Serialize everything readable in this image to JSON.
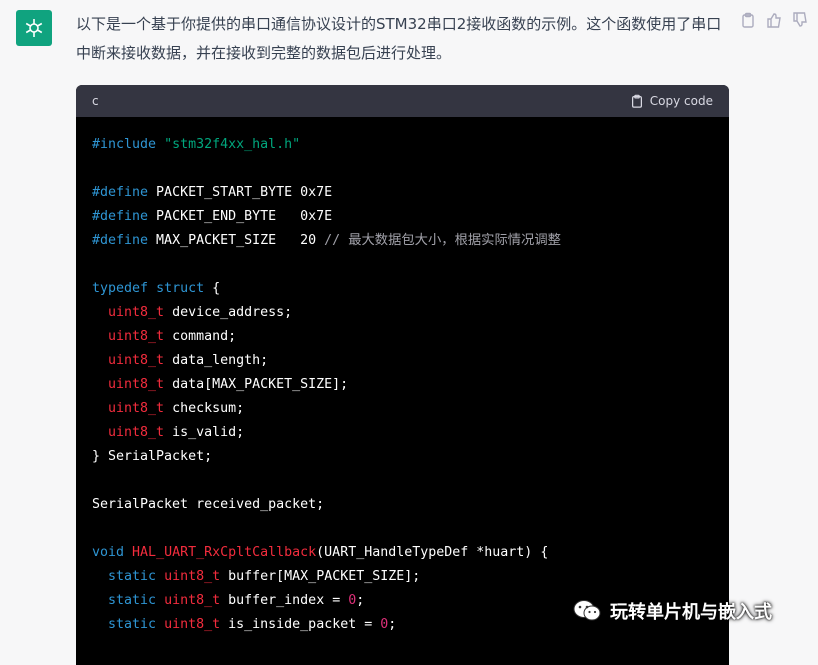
{
  "message": {
    "text": "以下是一个基于你提供的串口通信协议设计的STM32串口2接收函数的示例。这个函数使用了串口中断来接收数据，并在接收到完整的数据包后进行处理。"
  },
  "code_block": {
    "language": "c",
    "copy_label": "Copy code",
    "lines": [
      [
        {
          "t": "kw",
          "v": "#include "
        },
        {
          "t": "str",
          "v": "\"stm32f4xx_hal.h\""
        }
      ],
      [],
      [
        {
          "t": "kw",
          "v": "#define"
        },
        {
          "t": "pl",
          "v": " PACKET_START_BYTE 0x7E"
        }
      ],
      [
        {
          "t": "kw",
          "v": "#define"
        },
        {
          "t": "pl",
          "v": " PACKET_END_BYTE   0x7E"
        }
      ],
      [
        {
          "t": "kw",
          "v": "#define"
        },
        {
          "t": "pl",
          "v": " MAX_PACKET_SIZE   20 "
        },
        {
          "t": "cmt",
          "v": "// 最大数据包大小，根据实际情况调整"
        }
      ],
      [],
      [
        {
          "t": "kw",
          "v": "typedef"
        },
        {
          "t": "pl",
          "v": " "
        },
        {
          "t": "kw",
          "v": "struct"
        },
        {
          "t": "pl",
          "v": " {"
        }
      ],
      [
        {
          "t": "pl",
          "v": "  "
        },
        {
          "t": "ty",
          "v": "uint8_t"
        },
        {
          "t": "pl",
          "v": " device_address;"
        }
      ],
      [
        {
          "t": "pl",
          "v": "  "
        },
        {
          "t": "ty",
          "v": "uint8_t"
        },
        {
          "t": "pl",
          "v": " command;"
        }
      ],
      [
        {
          "t": "pl",
          "v": "  "
        },
        {
          "t": "ty",
          "v": "uint8_t"
        },
        {
          "t": "pl",
          "v": " data_length;"
        }
      ],
      [
        {
          "t": "pl",
          "v": "  "
        },
        {
          "t": "ty",
          "v": "uint8_t"
        },
        {
          "t": "pl",
          "v": " data[MAX_PACKET_SIZE];"
        }
      ],
      [
        {
          "t": "pl",
          "v": "  "
        },
        {
          "t": "ty",
          "v": "uint8_t"
        },
        {
          "t": "pl",
          "v": " checksum;"
        }
      ],
      [
        {
          "t": "pl",
          "v": "  "
        },
        {
          "t": "ty",
          "v": "uint8_t"
        },
        {
          "t": "pl",
          "v": " is_valid;"
        }
      ],
      [
        {
          "t": "pl",
          "v": "} SerialPacket;"
        }
      ],
      [],
      [
        {
          "t": "pl",
          "v": "SerialPacket received_packet;"
        }
      ],
      [],
      [
        {
          "t": "kw",
          "v": "void"
        },
        {
          "t": "pl",
          "v": " "
        },
        {
          "t": "fn",
          "v": "HAL_UART_RxCpltCallback"
        },
        {
          "t": "pl",
          "v": "(UART_HandleTypeDef *huart) {"
        }
      ],
      [
        {
          "t": "pl",
          "v": "  "
        },
        {
          "t": "kw",
          "v": "static"
        },
        {
          "t": "pl",
          "v": " "
        },
        {
          "t": "ty",
          "v": "uint8_t"
        },
        {
          "t": "pl",
          "v": " buffer[MAX_PACKET_SIZE];"
        }
      ],
      [
        {
          "t": "pl",
          "v": "  "
        },
        {
          "t": "kw",
          "v": "static"
        },
        {
          "t": "pl",
          "v": " "
        },
        {
          "t": "ty",
          "v": "uint8_t"
        },
        {
          "t": "pl",
          "v": " buffer_index = "
        },
        {
          "t": "num",
          "v": "0"
        },
        {
          "t": "pl",
          "v": ";"
        }
      ],
      [
        {
          "t": "pl",
          "v": "  "
        },
        {
          "t": "kw",
          "v": "static"
        },
        {
          "t": "pl",
          "v": " "
        },
        {
          "t": "ty",
          "v": "uint8_t"
        },
        {
          "t": "pl",
          "v": " is_inside_packet = "
        },
        {
          "t": "num",
          "v": "0"
        },
        {
          "t": "pl",
          "v": ";"
        }
      ]
    ]
  },
  "watermark": {
    "text": "玩转单片机与嵌入式"
  },
  "colors": {
    "avatar_bg": "#10a37f",
    "code_bg": "#000000",
    "header_bg": "#343541",
    "keyword": "#2e95d3",
    "type": "#f22c3d",
    "string": "#00a67d",
    "number": "#df3079"
  },
  "icons": [
    "openai-logo-icon",
    "clipboard-icon",
    "thumbs-up-icon",
    "thumbs-down-icon",
    "copy-icon",
    "wechat-icon"
  ]
}
